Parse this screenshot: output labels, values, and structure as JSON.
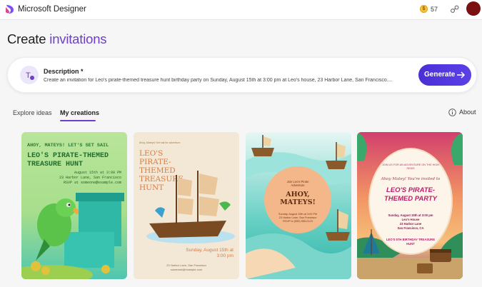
{
  "app": {
    "title": "Microsoft Designer",
    "coins": "57"
  },
  "page": {
    "title_prefix": "Create ",
    "title_accent": "invitations"
  },
  "description": {
    "label": "Description *",
    "text": "Create an invitation for Leo's pirate-themed treasure hunt birthday party on Sunday, August 15th at 3:00 pm at Leo's house, 23 Harbor Lane, San Francisco....",
    "generate_label": "Generate"
  },
  "tabs": [
    {
      "label": "Explore ideas",
      "active": false
    },
    {
      "label": "My creations",
      "active": true
    }
  ],
  "about_label": "About",
  "colors": {
    "accent": "#6d3fc6",
    "button": "#4b2fd6"
  },
  "icons": [
    "designer-logo-icon",
    "coin-icon",
    "share-icon",
    "avatar",
    "text-edit-icon",
    "arrow-right-icon",
    "info-icon"
  ],
  "cards": [
    {
      "header": "AHOY, MATEYS! LET'S SET SAIL",
      "title": "LEO'S PIRATE-THEMED TREASURE HUNT",
      "info": [
        "August 15th at 3:00 PM",
        "23 Harbor Lane, San Francisco",
        "RSVP at someone@example.com"
      ]
    },
    {
      "small": "Ahoy, Mateys! Set sail for adventure",
      "title": "LEO'S PIRATE-THEMED TREASURE HUNT",
      "date": [
        "Sunday, August 15th at",
        "3:00 pm"
      ],
      "address": [
        "23 Harbor Lane, San Francisco",
        "someone@example.com"
      ]
    },
    {
      "small": [
        "Join Leo's Pirate",
        "Adventure"
      ],
      "title": [
        "AHOY,",
        "MATEYS!"
      ],
      "info": [
        "Sunday, August 15th at 3:00 PM",
        "23 Harbor Lane, San Francisco",
        "RSVP to (555) 555-0123"
      ]
    },
    {
      "small": [
        "JOIN US FOR AN ADVENTURE ON THE HIGH",
        "SEAS!"
      ],
      "script": "Ahoy Matey! You're invited to",
      "title": [
        "LEO'S PIRATE-",
        "THEMED PARTY"
      ],
      "info": [
        "Sunday, August 15th at 3:00 pm",
        "Leo's House",
        "23 Harbor Lane",
        "San Francisco, CA"
      ],
      "footer": [
        "LEO'S 5TH BIRTHDAY TREASURE",
        "HUNT"
      ]
    }
  ]
}
